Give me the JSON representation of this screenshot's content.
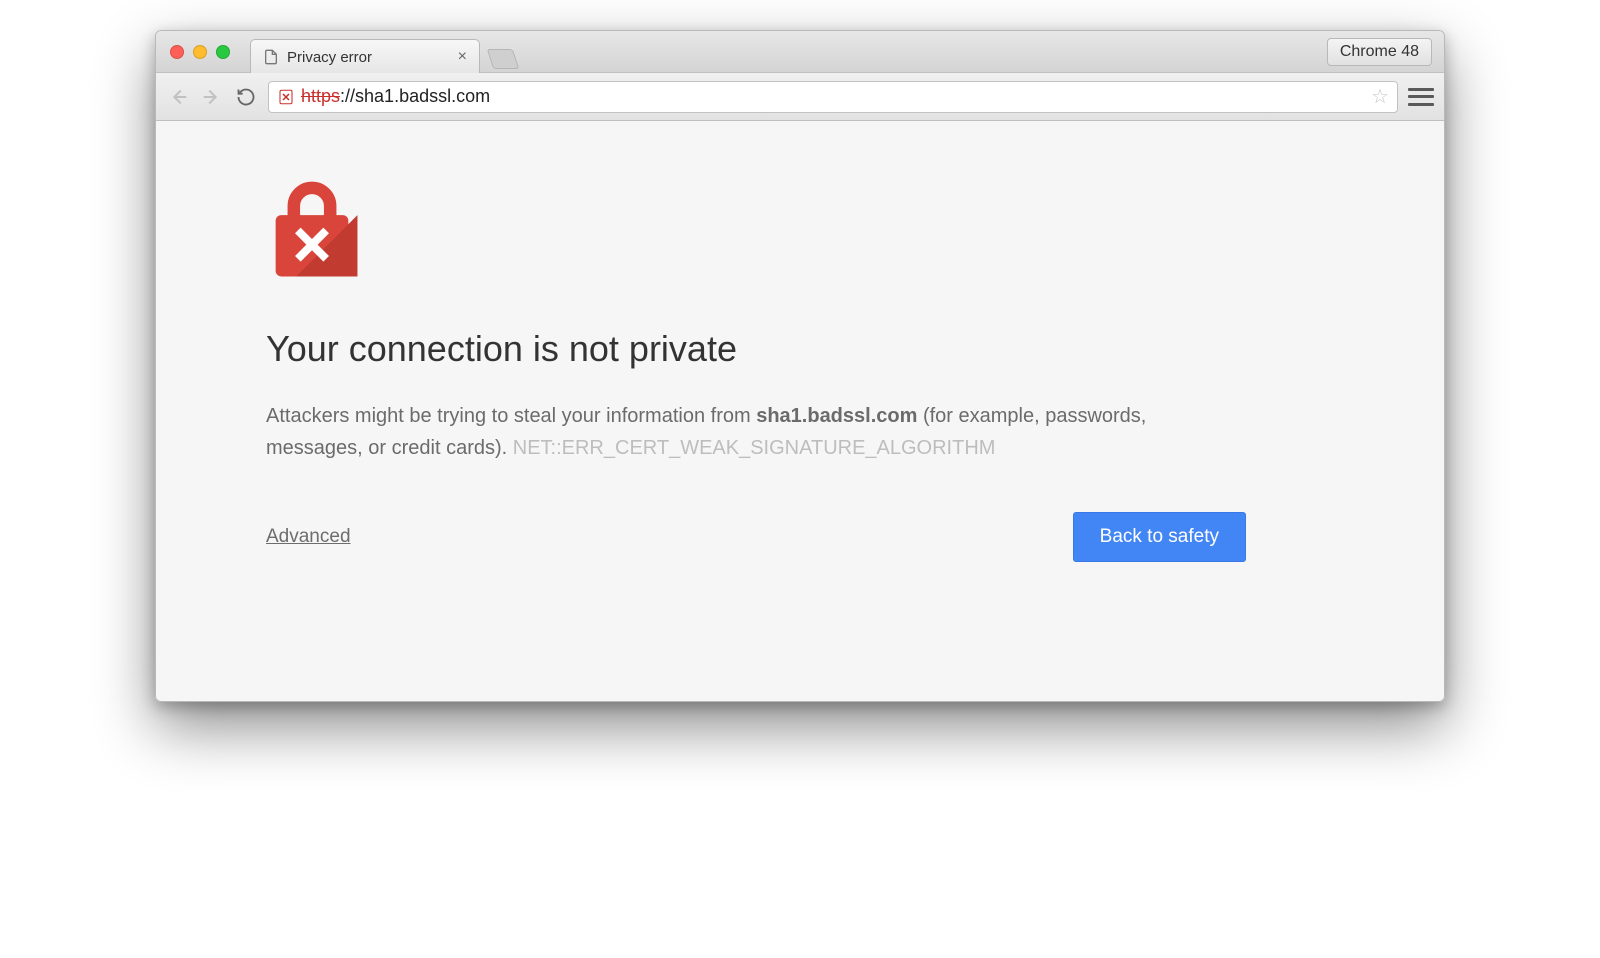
{
  "window": {
    "traffic": [
      "close",
      "minimize",
      "maximize"
    ],
    "version_pill": "Chrome 48"
  },
  "tab": {
    "title": "Privacy error"
  },
  "toolbar": {
    "url_scheme": "https",
    "url_rest": "://sha1.badssl.com"
  },
  "interstitial": {
    "title": "Your connection is not private",
    "body_prefix": "Attackers might be trying to steal your information from ",
    "body_host": "sha1.badssl.com",
    "body_suffix": " (for example, passwords, messages, or credit cards). ",
    "error_code": "NET::ERR_CERT_WEAK_SIGNATURE_ALGORITHM",
    "advanced_label": "Advanced",
    "safety_label": "Back to safety"
  }
}
